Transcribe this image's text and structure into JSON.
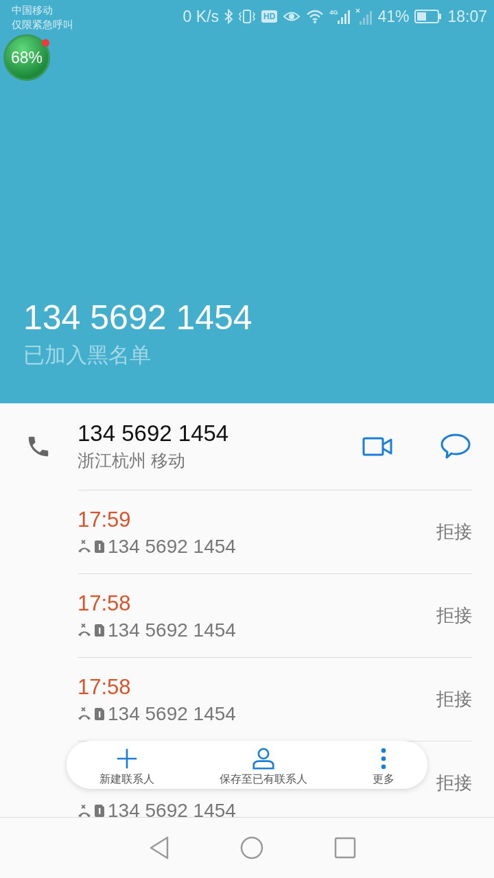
{
  "status_bar": {
    "carrier": "中国移动",
    "notice": "仅限紧急呼叫",
    "speed": "0 K/s",
    "hd": "HD",
    "network": "4G",
    "battery": "41%",
    "time": "18:07"
  },
  "float_ball": {
    "text": "68%",
    "badge": true
  },
  "header": {
    "number": "134 5692 1454",
    "status": "已加入黑名单"
  },
  "contact": {
    "number": "134 5692 1454",
    "location": "浙江杭州 移动"
  },
  "calls": [
    {
      "time": "17:59",
      "number": "134 5692 1454",
      "result": "拒接",
      "kind": "rejected"
    },
    {
      "time": "17:58",
      "number": "134 5692 1454",
      "result": "拒接",
      "kind": "rejected"
    },
    {
      "time": "17:58",
      "number": "134 5692 1454",
      "result": "拒接",
      "kind": "rejected"
    },
    {
      "number": "134 5692 1454",
      "result": "拒接",
      "kind": "rejected"
    }
  ],
  "toolbar": [
    {
      "label": "新建联系人",
      "kind": "add"
    },
    {
      "label": "保存至已有联系人",
      "kind": "person"
    },
    {
      "label": "更多",
      "kind": "more"
    }
  ]
}
